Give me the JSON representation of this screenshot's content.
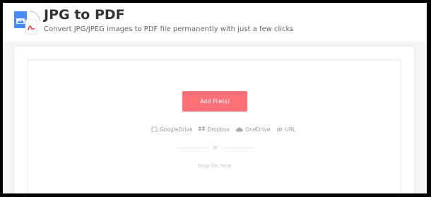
{
  "header": {
    "title": "JPG to PDF",
    "subtitle": "Convert JPG/JPEG images to PDF file permanently with just a few clicks",
    "icon": "jpg-to-pdf-icon"
  },
  "upload": {
    "add_button_label": "Add File(s)",
    "sources": [
      {
        "label": "GoogleDrive",
        "icon": "google-drive-icon"
      },
      {
        "label": "Dropbox",
        "icon": "dropbox-icon"
      },
      {
        "label": "OneDrive",
        "icon": "onedrive-icon"
      },
      {
        "label": "URL",
        "icon": "link-icon"
      }
    ],
    "or_text": "or",
    "drop_text": "Drop file here"
  },
  "colors": {
    "accent": "#ff7078",
    "doc_blue": "#4a8af4",
    "pdf_red": "#e53935"
  }
}
